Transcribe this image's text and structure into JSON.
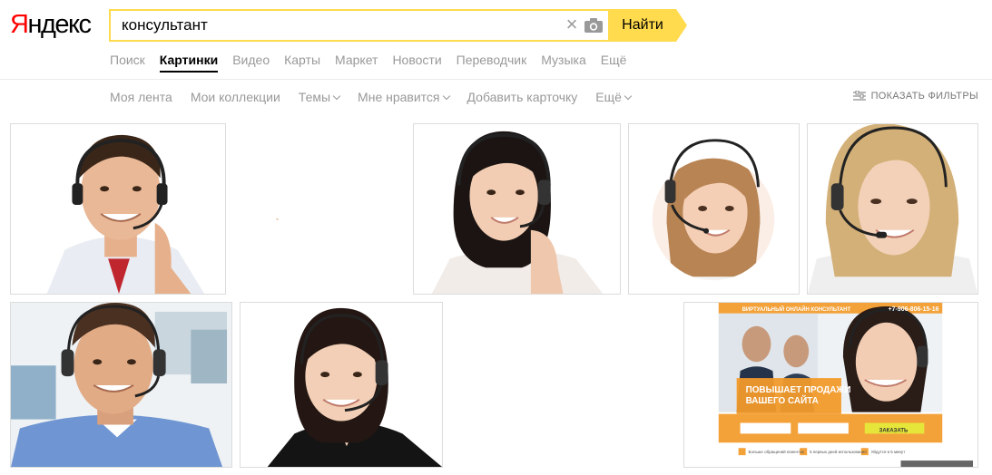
{
  "logo": {
    "first": "Я",
    "rest": "ндекс"
  },
  "search": {
    "query": "консультант"
  },
  "search_button": "Найти",
  "services": [
    "Поиск",
    "Картинки",
    "Видео",
    "Карты",
    "Маркет",
    "Новости",
    "Переводчик",
    "Музыка",
    "Ещё"
  ],
  "active_service": "Картинки",
  "subnav": {
    "feed": "Моя лента",
    "collections": "Мои коллекции",
    "themes": "Темы",
    "likes": "Мне нравится",
    "add_card": "Добавить карточку",
    "more": "Ещё"
  },
  "filters_label": "ПОКАЗАТЬ ФИЛЬТРЫ",
  "tiles": {
    "t9": {
      "brand_line": "ВИРТУАЛЬНЫЙ ОНЛАЙН КОНСУЛЬТАНТ",
      "phone": "+7-906-806-15-16",
      "headline1": "ПОВЫШАЕТ ПРОДАЖИ",
      "headline2": "ВАШЕГО САЙТА",
      "cta": "ЗАКАЗАТЬ",
      "feature1": "Больше обращений клиентов",
      "feature2": "5 первых дней использования",
      "feature3": "Уйдутся в 5 минут"
    }
  },
  "colors": {
    "accent": "#ffdb4d",
    "logo_red": "#ff0000",
    "muted_text": "#999999"
  }
}
